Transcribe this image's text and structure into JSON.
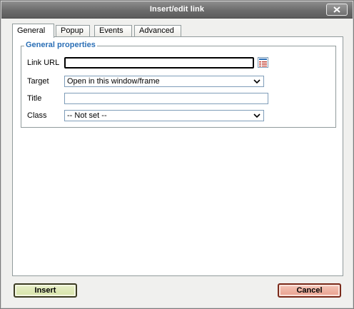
{
  "dialog": {
    "title": "Insert/edit link"
  },
  "tabs": [
    {
      "label": "General",
      "active": true
    },
    {
      "label": "Popup",
      "active": false
    },
    {
      "label": "Events",
      "active": false
    },
    {
      "label": "Advanced",
      "active": false
    }
  ],
  "general": {
    "legend": "General properties",
    "link_url": {
      "label": "Link URL",
      "value": ""
    },
    "target": {
      "label": "Target",
      "selected": "Open in this window/frame"
    },
    "title": {
      "label": "Title",
      "value": ""
    },
    "class": {
      "label": "Class",
      "selected": "-- Not set --"
    }
  },
  "buttons": {
    "insert": "Insert",
    "cancel": "Cancel"
  },
  "colors": {
    "legend": "#2b6fb6",
    "titlebar": "#6b6b6b",
    "insert_bg": "#d6e2a8",
    "cancel_bg": "#e9a08e"
  },
  "icons": {
    "close": "close-icon",
    "browse": "browse-list-icon",
    "dropdown": "chevron-down-icon"
  }
}
